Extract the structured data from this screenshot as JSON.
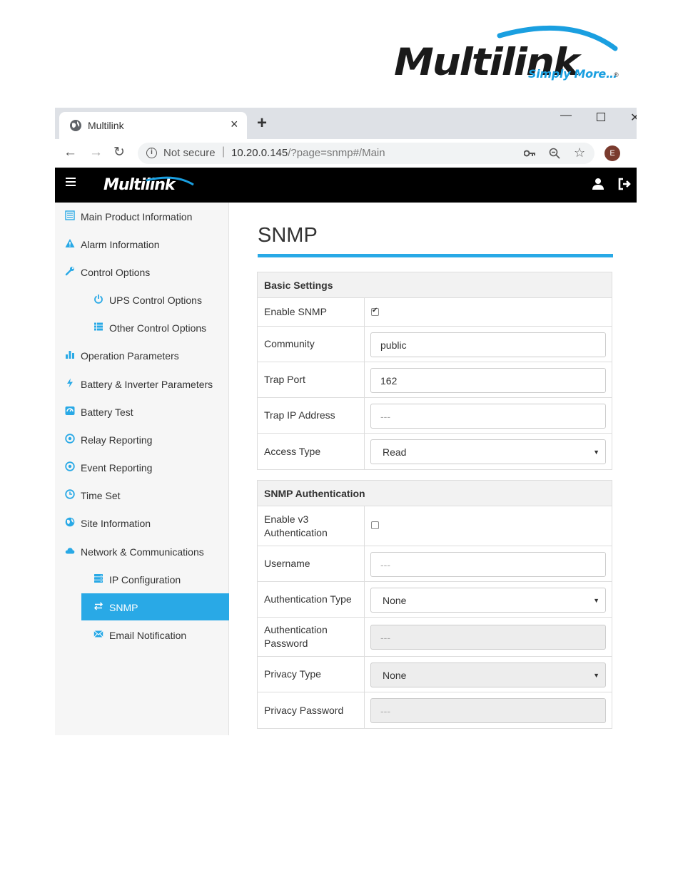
{
  "brand": {
    "name": "Multilink",
    "registered": "®",
    "tagline": "Simply More…"
  },
  "browser": {
    "tab_title": "Multilink",
    "tab_close": "×",
    "new_tab": "+",
    "security_label": "Not secure",
    "url_host": "10.20.0.145",
    "url_path": "/?page=snmp#/Main",
    "profile_initial": "E",
    "controls": {
      "minimize": "—",
      "close": "✕"
    }
  },
  "app": {
    "logo_text": "Multilink"
  },
  "sidebar": {
    "items": [
      {
        "label": "Main Product Information",
        "icon": "list-icon",
        "level": 1
      },
      {
        "label": "Alarm Information",
        "icon": "warning-icon",
        "level": 1
      },
      {
        "label": "Control Options",
        "icon": "wrench-icon",
        "level": 1
      },
      {
        "label": "UPS Control Options",
        "icon": "power-icon",
        "level": 2
      },
      {
        "label": "Other Control Options",
        "icon": "list-icon",
        "level": 2
      },
      {
        "label": "Operation Parameters",
        "icon": "bar-chart-icon",
        "level": 1
      },
      {
        "label": "Battery & Inverter Parameters",
        "icon": "bolt-icon",
        "level": 1
      },
      {
        "label": "Battery Test",
        "icon": "gauge-icon",
        "level": 1
      },
      {
        "label": "Relay Reporting",
        "icon": "target-icon",
        "level": 1
      },
      {
        "label": "Event Reporting",
        "icon": "target-icon",
        "level": 1
      },
      {
        "label": "Time Set",
        "icon": "clock-icon",
        "level": 1
      },
      {
        "label": "Site Information",
        "icon": "globe-icon",
        "level": 1
      },
      {
        "label": "Network & Communications",
        "icon": "cloud-icon",
        "level": 1
      },
      {
        "label": "IP Configuration",
        "icon": "server-icon",
        "level": 2
      },
      {
        "label": "SNMP",
        "icon": "transfer-icon",
        "level": 2,
        "active": true
      },
      {
        "label": "Email Notification",
        "icon": "envelope-icon",
        "level": 2
      }
    ]
  },
  "page": {
    "title": "SNMP"
  },
  "basic": {
    "heading": "Basic Settings",
    "enable_label": "Enable SNMP",
    "enable_checked": true,
    "community_label": "Community",
    "community_value": "public",
    "trap_port_label": "Trap Port",
    "trap_port_value": "162",
    "trap_ip_label": "Trap IP Address",
    "trap_ip_placeholder": "---",
    "access_label": "Access Type",
    "access_value": "Read"
  },
  "auth": {
    "heading": "SNMP Authentication",
    "enable_label": "Enable v3 Authentication",
    "enable_checked": false,
    "username_label": "Username",
    "username_placeholder": "---",
    "auth_type_label": "Authentication Type",
    "auth_type_value": "None",
    "auth_password_label": "Authentication Password",
    "auth_password_placeholder": "---",
    "privacy_type_label": "Privacy Type",
    "privacy_type_value": "None",
    "privacy_password_label": "Privacy Password",
    "privacy_password_placeholder": "---"
  },
  "colors": {
    "accent": "#29a9e6",
    "appbar": "#000000",
    "sidebar_bg": "#f6f6f6",
    "brand_blue": "#1a9fe0"
  }
}
